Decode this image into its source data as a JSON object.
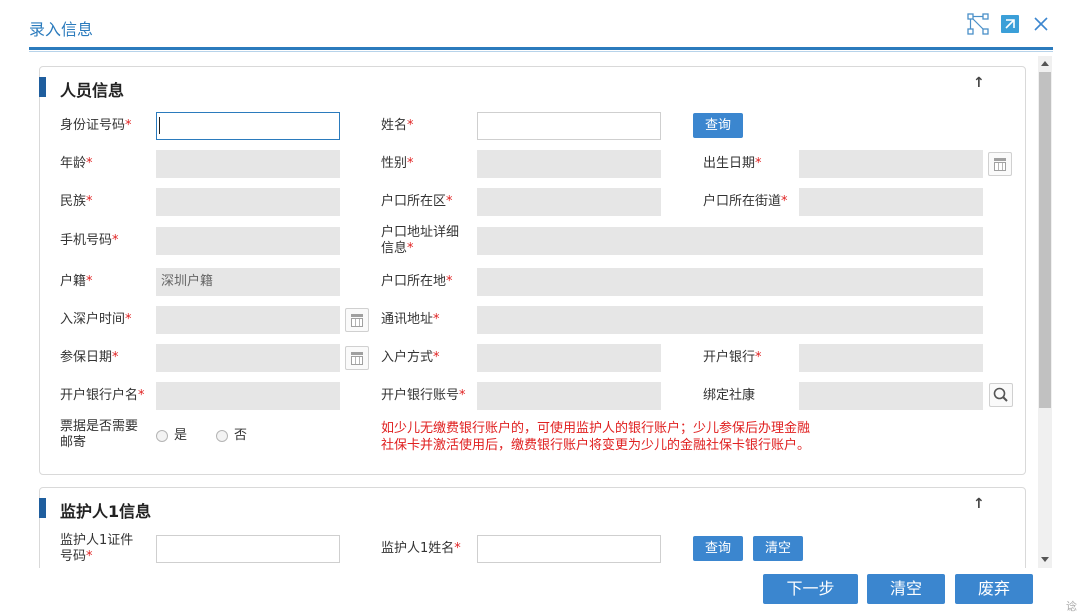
{
  "dialog": {
    "title": "录入信息",
    "icons": [
      "network-icon",
      "popout-icon",
      "close-icon"
    ]
  },
  "person_section": {
    "title": "人员信息",
    "fields": {
      "id_number": {
        "label": "身份证号码",
        "value": ""
      },
      "name": {
        "label": "姓名",
        "value": ""
      },
      "query_btn": "查询",
      "age": {
        "label": "年龄",
        "value": ""
      },
      "gender": {
        "label": "性别",
        "value": ""
      },
      "birth_date": {
        "label": "出生日期",
        "value": ""
      },
      "ethnicity": {
        "label": "民族",
        "value": ""
      },
      "hukou_district": {
        "label": "户口所在区",
        "value": ""
      },
      "hukou_street": {
        "label": "户口所在街道",
        "value": ""
      },
      "phone": {
        "label": "手机号码",
        "value": ""
      },
      "hukou_detail": {
        "label_line1": "户口地址详细",
        "label_line2": "信息",
        "value": ""
      },
      "hukou_type": {
        "label": "户籍",
        "value": "深圳户籍"
      },
      "hukou_location": {
        "label": "户口所在地",
        "value": ""
      },
      "sz_hukou_time": {
        "label": "入深户时间",
        "value": ""
      },
      "mail_address": {
        "label": "通讯地址",
        "value": ""
      },
      "insured_date": {
        "label": "参保日期",
        "value": ""
      },
      "hukou_method": {
        "label": "入户方式",
        "value": ""
      },
      "bank": {
        "label": "开户银行",
        "value": ""
      },
      "bank_account_name": {
        "label": "开户银行户名",
        "value": ""
      },
      "bank_account_no": {
        "label": "开户银行账号",
        "value": ""
      },
      "bind_shekang": {
        "label": "绑定社康",
        "value": ""
      },
      "receipt_mail": {
        "label_line1": "票据是否需要",
        "label_line2": "邮寄",
        "option_yes": "是",
        "option_no": "否"
      },
      "note_line1": "如少儿无缴费银行账户的，可使用监护人的银行账户；少儿参保后办理金融",
      "note_line2": "社保卡并激活使用后，缴费银行账户将变更为少儿的金融社保卡银行账户。"
    }
  },
  "guardian_section": {
    "title": "监护人1信息",
    "id_label_line1": "监护人1证件",
    "id_label_line2": "号码",
    "name_label": "监护人1姓名",
    "query_btn": "查询",
    "clear_btn": "清空"
  },
  "footer": {
    "next": "下一步",
    "clear": "清空",
    "discard": "废弃"
  },
  "corner_text": "谂",
  "colors": {
    "accent": "#2b7bbd",
    "button": "#3b86cf",
    "required": "#e02020",
    "readonly_bg": "#e6e6e6"
  }
}
